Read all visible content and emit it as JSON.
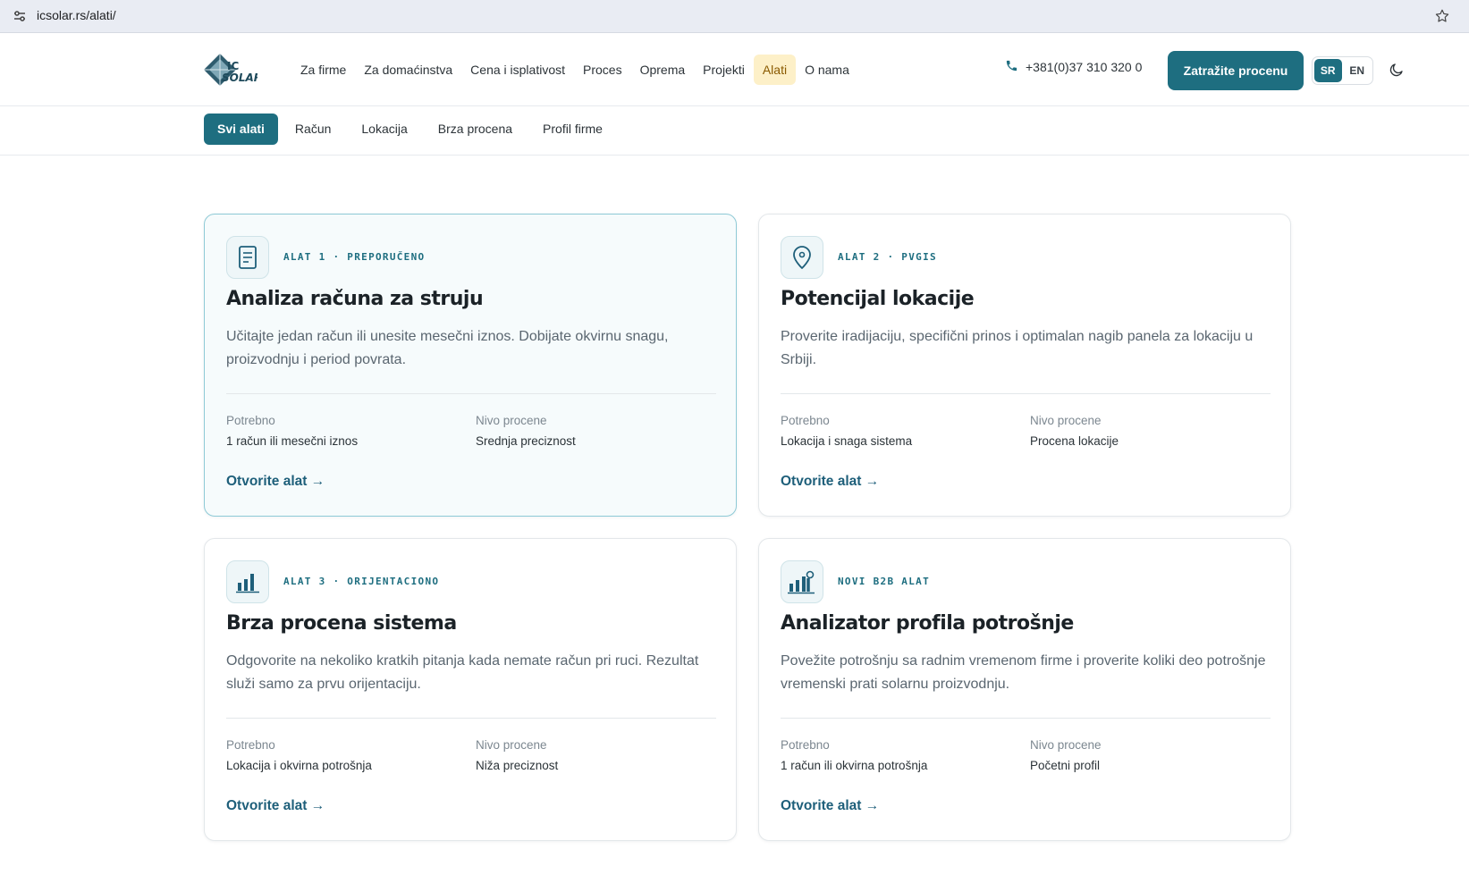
{
  "browser": {
    "url": "icsolar.rs/alati/"
  },
  "header": {
    "logo_text": "IC SOLAR",
    "nav": [
      {
        "label": "Za firme"
      },
      {
        "label": "Za domaćinstva"
      },
      {
        "label": "Cena i isplativost"
      },
      {
        "label": "Proces"
      },
      {
        "label": "Oprema"
      },
      {
        "label": "Projekti"
      },
      {
        "label": "Alati",
        "active": true
      },
      {
        "label": "O nama"
      }
    ],
    "phone": "+381(0)37 310 320 0",
    "cta_label": "Zatražite procenu",
    "languages": [
      "SR",
      "EN"
    ],
    "active_language": "SR"
  },
  "sub_nav": {
    "tabs": [
      {
        "label": "Svi alati",
        "active": true
      },
      {
        "label": "Račun"
      },
      {
        "label": "Lokacija"
      },
      {
        "label": "Brza procena"
      },
      {
        "label": "Profil firme"
      }
    ]
  },
  "cards": [
    {
      "icon": "document-icon",
      "tag": "ALAT 1 · PREPORUČENO",
      "title": "Analiza računa za struju",
      "description": "Učitajte jedan račun ili unesite mesečni iznos. Dobijate okvirnu snagu, proizvodnju i period povrata.",
      "meta_required_label": "Potrebno",
      "meta_required_value": "1 račun ili mesečni iznos",
      "meta_level_label": "Nivo procene",
      "meta_level_value": "Srednja preciznost",
      "link": "Otvorite alat →",
      "featured": true
    },
    {
      "icon": "location-pin-icon",
      "tag": "ALAT 2 · PVGIS",
      "title": "Potencijal lokacije",
      "description": "Proverite iradijaciju, specifični prinos i optimalan nagib panela za lokaciju u Srbiji.",
      "meta_required_label": "Potrebno",
      "meta_required_value": "Lokacija i snaga sistema",
      "meta_level_label": "Nivo procene",
      "meta_level_value": "Procena lokacije",
      "link": "Otvorite alat →"
    },
    {
      "icon": "bar-chart-icon",
      "tag": "ALAT 3 · ORIJENTACIONO",
      "title": "Brza procena sistema",
      "description": "Odgovorite na nekoliko kratkih pitanja kada nemate račun pri ruci. Rezultat služi samo za prvu orijentaciju.",
      "meta_required_label": "Potrebno",
      "meta_required_value": "Lokacija i okvirna potrošnja",
      "meta_level_label": "Nivo procene",
      "meta_level_value": "Niža preciznost",
      "link": "Otvorite alat →"
    },
    {
      "icon": "chart-search-icon",
      "tag": "NOVI B2B ALAT",
      "title": "Analizator profila potrošnje",
      "description": "Povežite potrošnju sa radnim vremenom firme i proverite koliki deo potrošnje vremenski prati solarnu proizvodnju.",
      "meta_required_label": "Potrebno",
      "meta_required_value": "1 račun ili okvirna potrošnja",
      "meta_level_label": "Nivo procene",
      "meta_level_value": "Početni profil",
      "link": "Otvorite alat →"
    }
  ],
  "colors": {
    "brand": "#1e6e80",
    "active_nav_bg": "#fdf0c8",
    "featured_border": "#8ecad6"
  }
}
